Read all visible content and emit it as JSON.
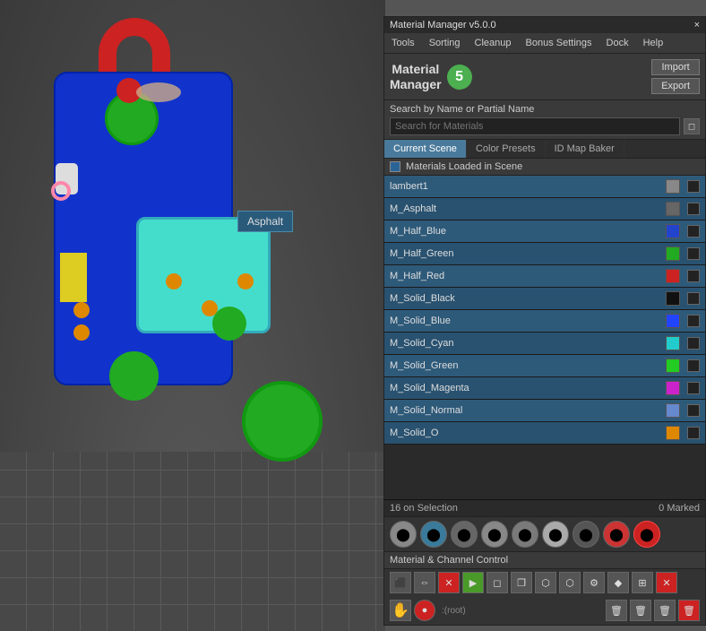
{
  "title": "Material Manager v5.0.0",
  "close_btn": "×",
  "menu": {
    "items": [
      "Tools",
      "Sorting",
      "Cleanup",
      "Bonus Settings",
      "Dock",
      "Help"
    ]
  },
  "logo": {
    "text_line1": "Material",
    "text_line2": "Manager",
    "badge": "5"
  },
  "buttons": {
    "import": "Import",
    "export": "Export"
  },
  "search": {
    "label": "Search by Name or Partial Name",
    "placeholder": "Search for Materials"
  },
  "tabs": [
    {
      "label": "Current Scene",
      "active": true
    },
    {
      "label": "Color Presets",
      "active": false
    },
    {
      "label": "ID Map Baker",
      "active": false
    }
  ],
  "scene_label": "Materials Loaded in Scene",
  "materials": [
    {
      "name": "lambert1",
      "color": "#888888"
    },
    {
      "name": "M_Asphalt",
      "color": "#666666"
    },
    {
      "name": "M_Half_Blue",
      "color": "#2244cc"
    },
    {
      "name": "M_Half_Green",
      "color": "#22aa22"
    },
    {
      "name": "M_Half_Red",
      "color": "#cc2222"
    },
    {
      "name": "M_Solid_Black",
      "color": "#111111"
    },
    {
      "name": "M_Solid_Blue",
      "color": "#2244ff"
    },
    {
      "name": "M_Solid_Cyan",
      "color": "#22cccc"
    },
    {
      "name": "M_Solid_Green",
      "color": "#22cc22"
    },
    {
      "name": "M_Solid_Magenta",
      "color": "#cc22cc"
    },
    {
      "name": "M_Solid_Normal",
      "color": "#6688cc"
    },
    {
      "name": "M_Solid_O",
      "color": "#dd8800"
    }
  ],
  "status": {
    "selection": "16  on Selection",
    "marked": "0  Marked"
  },
  "channel_control_label": "Material & Channel Control",
  "root_text": ":(root)",
  "asphalt_popup": "Asphalt"
}
